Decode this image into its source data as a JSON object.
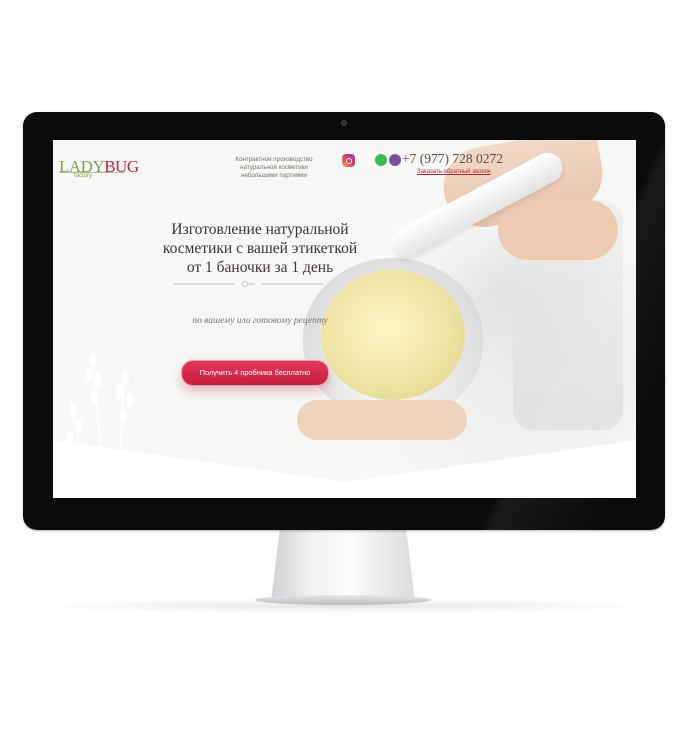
{
  "logo": {
    "lady": "LADY",
    "bug": "BUG",
    "factory": "factory"
  },
  "header": {
    "tagline": [
      "Контрактное производство",
      "натуральной косметики",
      "небольшими партиями"
    ],
    "phone": "+7 (977) 728 0272",
    "callback_link": "Заказать обратный звонок",
    "icons": [
      "instagram-icon",
      "whatsapp-icon",
      "viber-icon"
    ]
  },
  "hero": {
    "headline": [
      "Изготовление натуральной",
      "косметики с вашей этикеткой",
      "от 1 баночки за 1 день"
    ],
    "subtitle": "по вашему или готовому рецепту",
    "cta_label": "Получить 4 пробника бесплатно"
  },
  "colors": {
    "brand_red": "#c3243b",
    "brand_green": "#7fa24a",
    "cta_gradient": [
      "#e6385a",
      "#c21e3f"
    ]
  }
}
